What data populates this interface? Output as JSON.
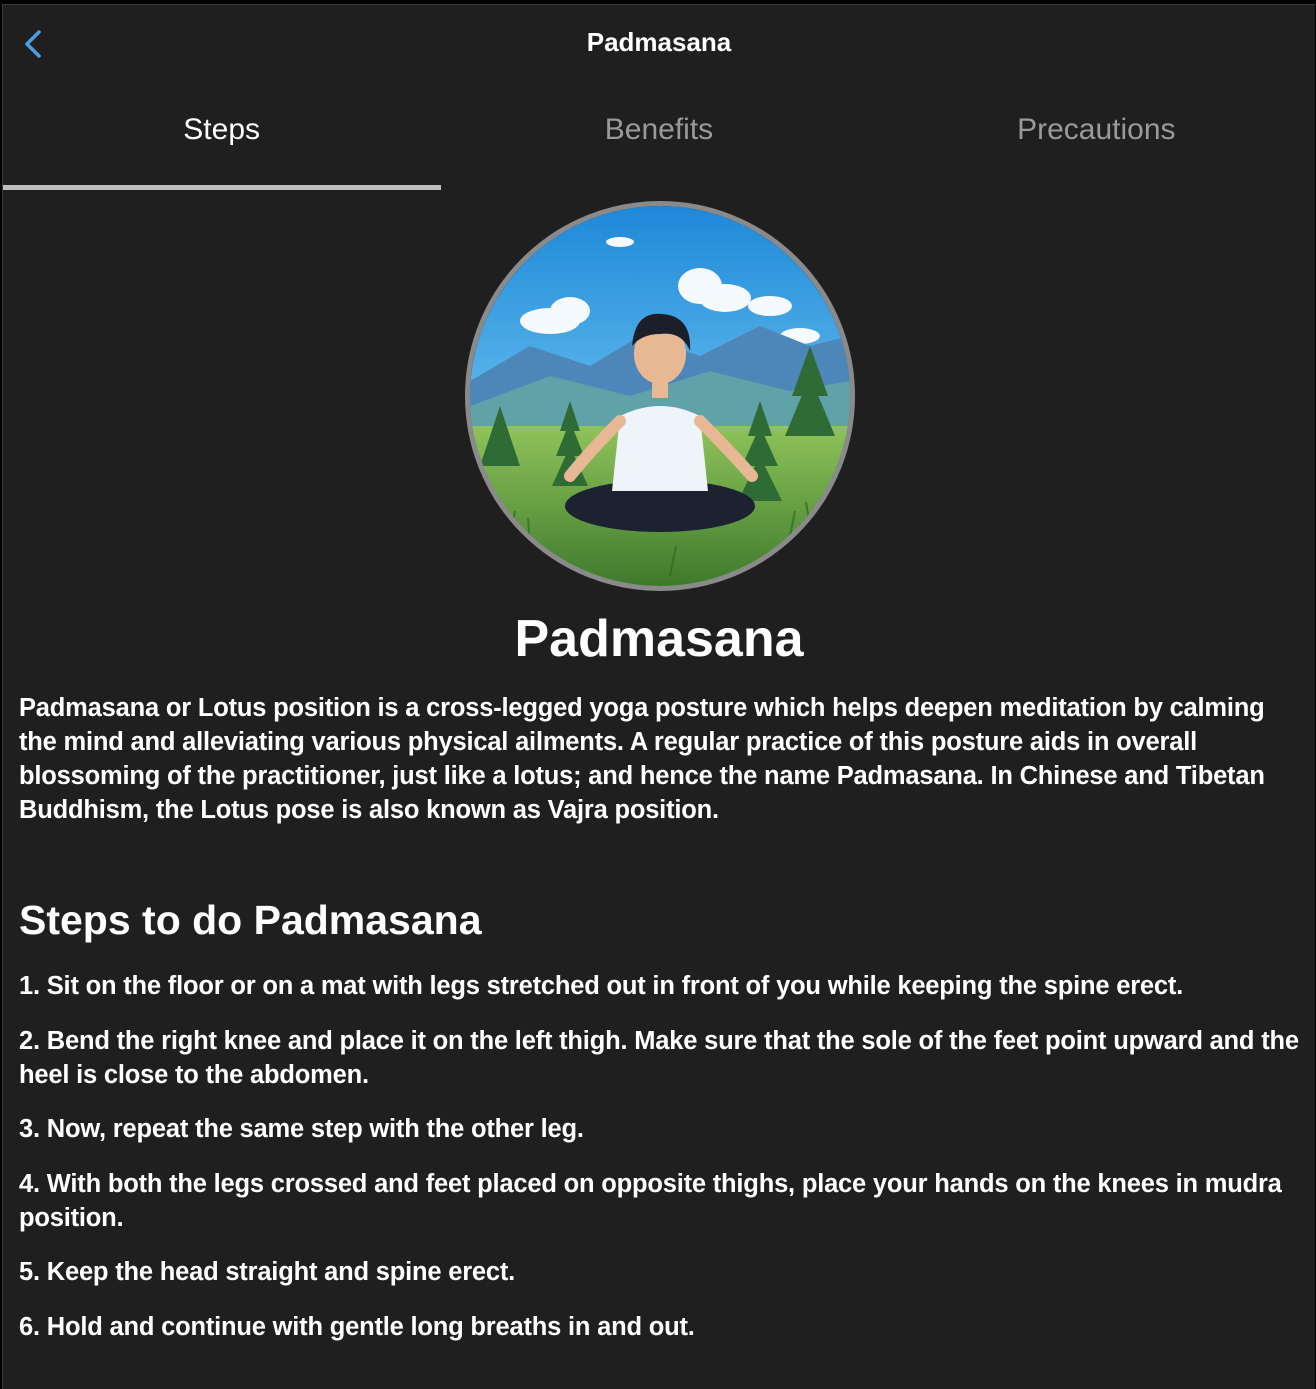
{
  "navbar": {
    "back_icon": "chevron-left-icon",
    "title": "Padmasana",
    "accent_color": "#4a9fe0"
  },
  "tabs": [
    {
      "label": "Steps",
      "active": true
    },
    {
      "label": "Benefits",
      "active": false
    },
    {
      "label": "Precautions",
      "active": false
    }
  ],
  "hero": {
    "alt": "Illustration of a person meditating in lotus position on a grassy hill with mountains and clouds"
  },
  "pose": {
    "title": "Padmasana",
    "description": "Padmasana or Lotus position is a cross-legged yoga posture which helps deepen meditation by calming the mind and alleviating various physical ailments. A regular practice of this posture aids in overall blossoming of the practitioner, just like a lotus; and hence the name Padmasana. In Chinese and Tibetan Buddhism, the Lotus pose is also known as Vajra position."
  },
  "steps": {
    "heading": "Steps to do Padmasana",
    "items": [
      "1. Sit on the floor or on a mat with legs stretched out in front of you while keeping the spine erect.",
      "2. Bend the right knee and place it on the left thigh. Make sure that the sole of the feet point upward and the heel is close to the abdomen.",
      "3. Now, repeat the same step with the other leg.",
      "4. With both the legs crossed and feet placed on opposite thighs, place your hands on the knees in mudra position.",
      "5. Keep the head straight and spine erect.",
      "6. Hold and continue with gentle long breaths in and out."
    ]
  }
}
